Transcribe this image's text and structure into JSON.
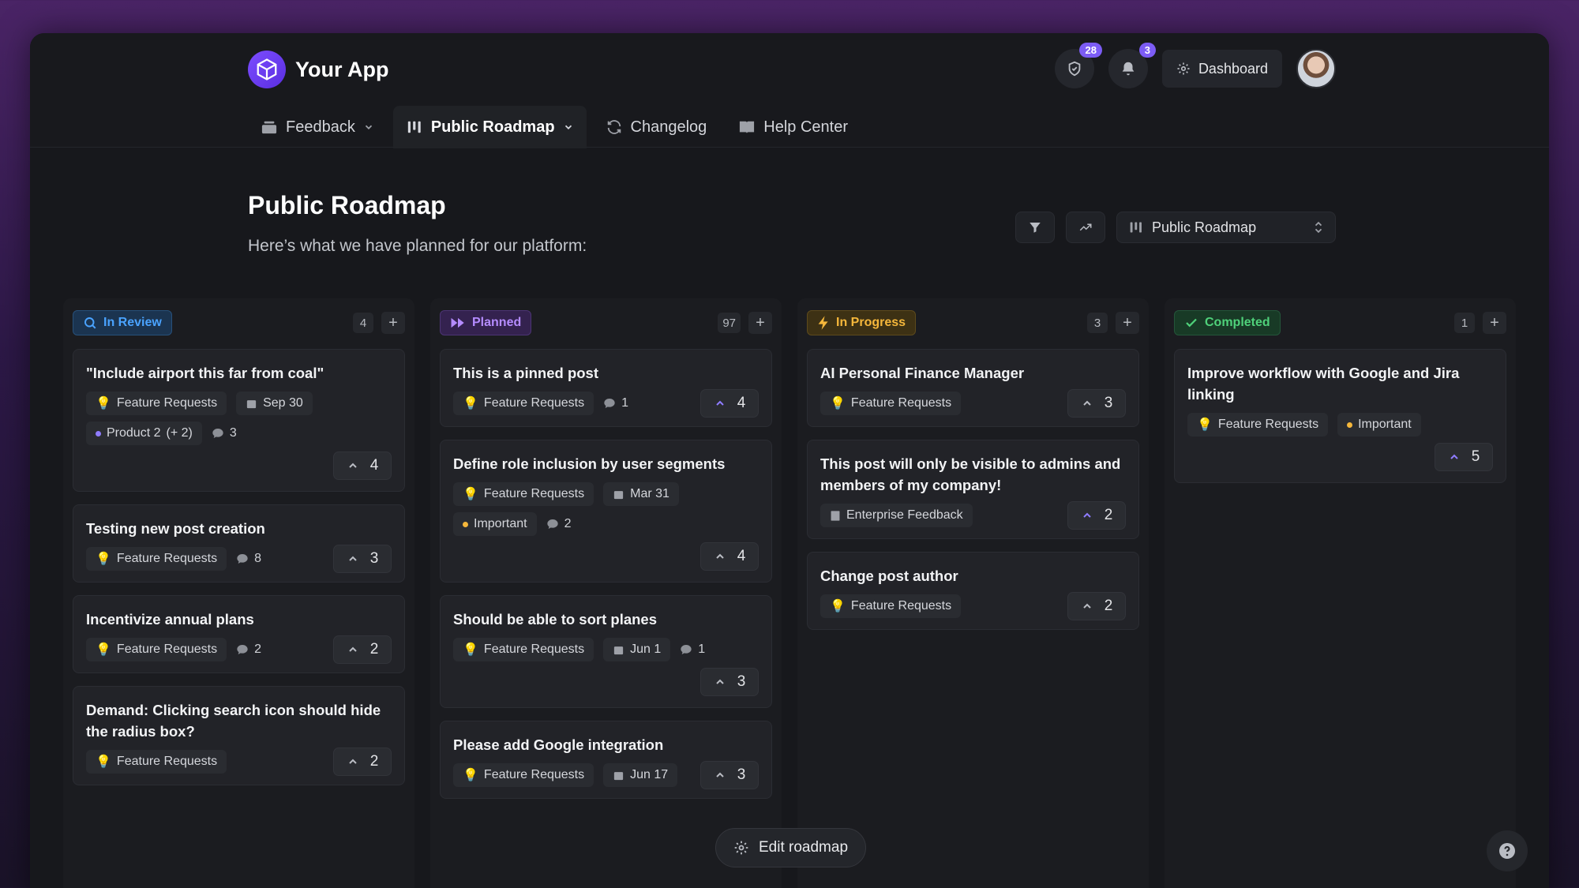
{
  "app": {
    "name": "Your App"
  },
  "header": {
    "shield_badge": "28",
    "bell_badge": "3",
    "dashboard_label": "Dashboard"
  },
  "nav": {
    "feedback": "Feedback",
    "roadmap": "Public Roadmap",
    "changelog": "Changelog",
    "help": "Help Center"
  },
  "page": {
    "title": "Public Roadmap",
    "subtitle": "Here’s what we have planned for our platform:",
    "roadmap_select": "Public Roadmap"
  },
  "columns": [
    {
      "label": "In Review",
      "count": "4",
      "color": "#4aa3ff",
      "cards": [
        {
          "title": "\"Include airport this far from coal\"",
          "tag": "Feature Requests",
          "date": "Sep 30",
          "product": "Product 2",
          "product_more": "(+ 2)",
          "comments": "3",
          "votes": "4"
        },
        {
          "title": "Testing new post creation",
          "tag": "Feature Requests",
          "comments": "8",
          "votes": "3"
        },
        {
          "title": "Incentivize annual plans",
          "tag": "Feature Requests",
          "comments": "2",
          "votes": "2"
        },
        {
          "title": "Demand: Clicking search icon should hide the radius box?",
          "tag": "Feature Requests",
          "votes": "2"
        }
      ]
    },
    {
      "label": "Planned",
      "count": "97",
      "color": "#a77bff",
      "cards": [
        {
          "title": "This is a pinned post",
          "tag": "Feature Requests",
          "comments": "1",
          "votes": "4"
        },
        {
          "title": "Define role inclusion by user segments",
          "tag": "Feature Requests",
          "date": "Mar 31",
          "priority": "Important",
          "comments": "2",
          "votes": "4"
        },
        {
          "title": "Should be able to sort planes",
          "tag": "Feature Requests",
          "date": "Jun 1",
          "comments": "1",
          "votes": "3"
        },
        {
          "title": "Please add Google integration",
          "tag": "Feature Requests",
          "date": "Jun 17",
          "votes": "3"
        }
      ]
    },
    {
      "label": "In Progress",
      "count": "3",
      "color": "#f5b73b",
      "cards": [
        {
          "title": "AI Personal Finance Manager",
          "tag": "Feature Requests",
          "votes": "3"
        },
        {
          "title": "This post will only be visible to admins and members of my company!",
          "tag": "Enterprise Feedback",
          "votes": "2"
        },
        {
          "title": "Change post author",
          "tag": "Feature Requests",
          "votes": "2"
        }
      ]
    },
    {
      "label": "Completed",
      "count": "1",
      "color": "#4fd17a",
      "cards": [
        {
          "title": "Improve workflow with Google and Jira linking",
          "tag": "Feature Requests",
          "priority": "Important",
          "votes": "5"
        }
      ]
    }
  ],
  "footer": {
    "edit_label": "Edit roadmap"
  }
}
